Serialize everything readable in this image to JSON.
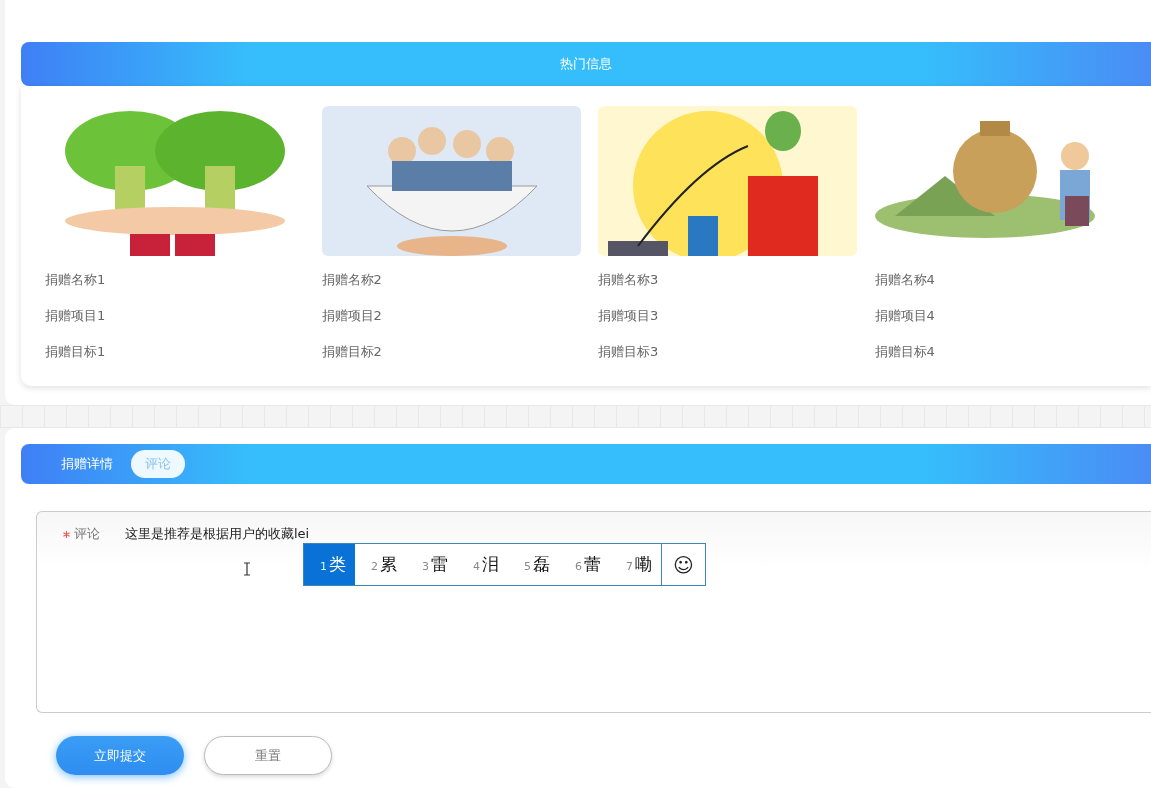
{
  "hot_info": {
    "title": "热门信息",
    "items": [
      {
        "name": "捐赠名称1",
        "project": "捐赠项目1",
        "target": "捐赠目标1"
      },
      {
        "name": "捐赠名称2",
        "project": "捐赠项目2",
        "target": "捐赠目标2"
      },
      {
        "name": "捐赠名称3",
        "project": "捐赠项目3",
        "target": "捐赠目标3"
      },
      {
        "name": "捐赠名称4",
        "project": "捐赠项目4",
        "target": "捐赠目标4"
      }
    ]
  },
  "detail": {
    "tabs": [
      {
        "label": "捐赠详情",
        "selected": false
      },
      {
        "label": "评论",
        "selected": true
      }
    ],
    "form": {
      "label": "评论",
      "required": true,
      "value": "这里是推荐是根据用户的收藏lei",
      "ime": {
        "candidates": [
          {
            "index": "1",
            "text": "类",
            "selected": true
          },
          {
            "index": "2",
            "text": "累",
            "selected": false
          },
          {
            "index": "3",
            "text": "雷",
            "selected": false
          },
          {
            "index": "4",
            "text": "泪",
            "selected": false
          },
          {
            "index": "5",
            "text": "磊",
            "selected": false
          },
          {
            "index": "6",
            "text": "蕾",
            "selected": false
          },
          {
            "index": "7",
            "text": "嘞",
            "selected": false
          }
        ],
        "emoji": "☺"
      }
    },
    "buttons": [
      {
        "label": "立即提交",
        "kind": "primary"
      },
      {
        "label": "重置",
        "kind": "secondary"
      }
    ]
  }
}
